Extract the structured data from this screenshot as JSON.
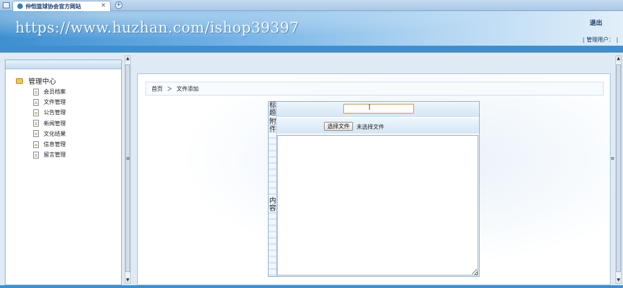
{
  "browser": {
    "tab_title": "仲恺篮球协会官方网站",
    "tab_close": "×",
    "new_tab": "+"
  },
  "header": {
    "watermark": "https://www.huzhan.com/ishop39397",
    "logout_label": "退出",
    "user_label": "管理用户："
  },
  "sidebar": {
    "root_label": "管理中心",
    "items": [
      "会员档案",
      "文件管理",
      "公告管理",
      "新闻管理",
      "文化结果",
      "信息管理",
      "留言管理"
    ]
  },
  "breadcrumb": {
    "home": "首页",
    "separator": "＞",
    "current": "文件添加"
  },
  "form": {
    "title_label": "标题",
    "title_value": "",
    "attachment_label": "附件",
    "file_button": "选择文件",
    "file_status": "未选择文件",
    "content_label": "内容",
    "content_value": ""
  },
  "scroll": {
    "up": "▲",
    "down": "▼",
    "grip": "≡"
  },
  "colors": {
    "header_blue": "#3d8fd1",
    "panel_border": "#8fb3d6",
    "input_focus": "#d39b43"
  }
}
